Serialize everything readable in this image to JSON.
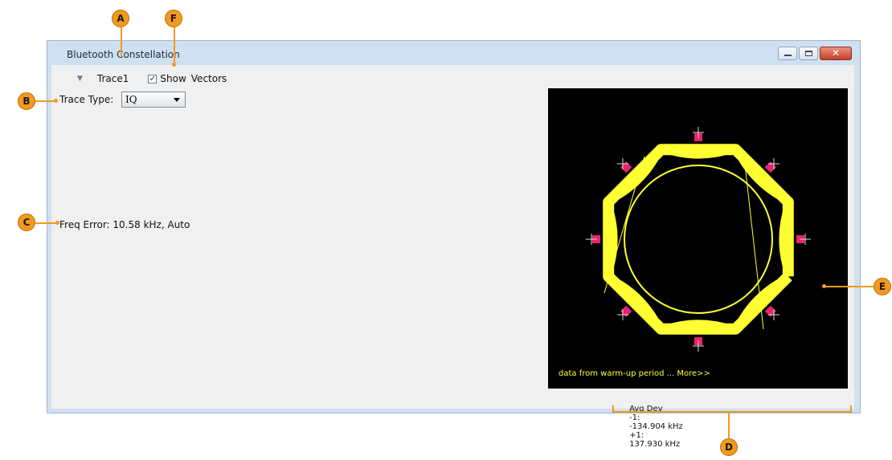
{
  "window": {
    "title": "Bluetooth Constellation"
  },
  "window_buttons": {
    "minimize": "minimize-icon",
    "maximize": "maximize-icon",
    "close": "close-icon"
  },
  "toolbar": {
    "trace": "Trace1",
    "show_checked": true,
    "show_label": "Show",
    "vectors_label": "Vectors"
  },
  "trace_type": {
    "label": "Trace Type:",
    "value": "IQ"
  },
  "freq_error": "Freq Error: 10.58 kHz, Auto",
  "plot": {
    "warmup": "data from warm-up period ... More>>",
    "trace_color": "#ffff33",
    "marker_color": "#e8226e"
  },
  "readout": {
    "label": "Avg Dev",
    "minus_label": "-1:",
    "minus_value": "-134.904 kHz",
    "plus_label": "+1:",
    "plus_value": "137.930 kHz"
  },
  "callouts": [
    "A",
    "B",
    "C",
    "D",
    "E",
    "F"
  ],
  "colors": {
    "callout": "#f29a1e",
    "title_bg": "#cfe0f1",
    "content_bg": "#f0f0f0"
  }
}
